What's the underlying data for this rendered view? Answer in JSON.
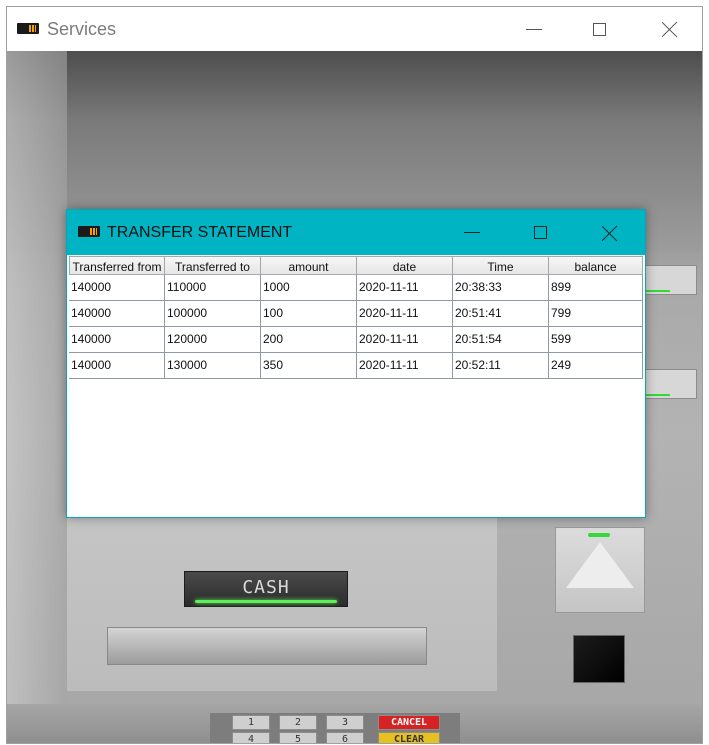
{
  "window": {
    "title": "Services"
  },
  "dialog": {
    "title": "TRANSFER STATEMENT",
    "columns": [
      "Transferred from",
      "Transferred to",
      "amount",
      "date",
      "Time",
      "balance"
    ],
    "rows": [
      [
        "140000",
        "110000",
        "1000",
        "2020-11-11",
        "20:38:33",
        "899"
      ],
      [
        "140000",
        "100000",
        "100",
        "2020-11-11",
        "20:51:41",
        "799"
      ],
      [
        "140000",
        "120000",
        "200",
        "2020-11-11",
        "20:51:54",
        "599"
      ],
      [
        "140000",
        "130000",
        "350",
        "2020-11-11",
        "20:52:11",
        "249"
      ]
    ]
  },
  "atm": {
    "cash_label": "CASH",
    "keys": [
      "1",
      "2",
      "3",
      "4",
      "5",
      "6"
    ],
    "cancel_label": "CANCEL",
    "clear_label": "CLEAR"
  },
  "icons": {
    "app": "app-icon",
    "minimize": "minimize-icon",
    "maximize": "maximize-icon",
    "close": "close-icon"
  },
  "colors": {
    "dialog_title_bar": "#00b4c4",
    "led_green": "#36d838",
    "cancel": "#d62222",
    "clear": "#e6c021"
  }
}
